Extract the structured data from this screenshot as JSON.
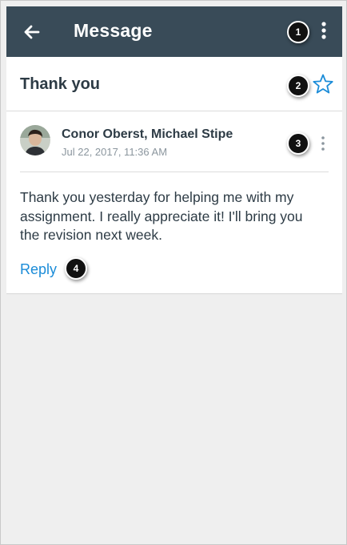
{
  "appbar": {
    "title": "Message",
    "back_icon": "arrow-left-icon",
    "menu_icon": "more-vertical-icon"
  },
  "conversation": {
    "subject": "Thank you",
    "star_icon": "star-outline-icon",
    "star_color": "#1b8cd8"
  },
  "message": {
    "participants": "Conor Oberst, Michael Stipe",
    "date": "Jul 22, 2017, 11:36 AM",
    "body_lines": [
      "Thank you yesterday for helping me with my",
      "assignment. I really appreciate it! I'll bring you",
      "the revision next week."
    ],
    "more_icon": "more-vertical-icon",
    "reply_label": "Reply"
  },
  "callouts": [
    "1",
    "2",
    "3",
    "4"
  ],
  "colors": {
    "appbar_bg": "#394b58",
    "text_primary": "#2d3b45",
    "text_secondary": "#8b969e",
    "link": "#1b8cd8",
    "background": "#efefef"
  }
}
